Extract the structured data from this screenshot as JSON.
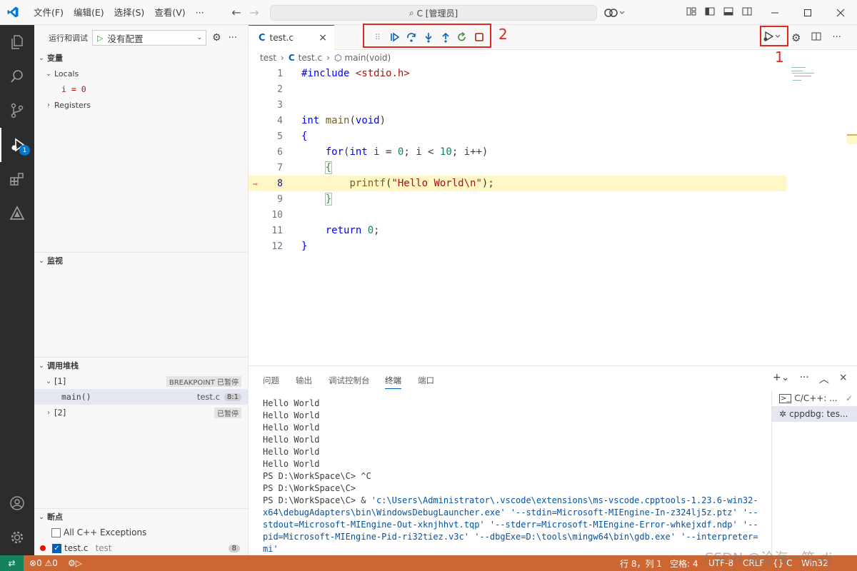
{
  "titlebar": {
    "menus": [
      "文件(F)",
      "编辑(E)",
      "选择(S)",
      "查看(V)",
      "···"
    ],
    "search_text": "C [管理员]"
  },
  "activitybar": {
    "debug_badge": "1"
  },
  "sidebar": {
    "header_label": "运行和调试",
    "config_select": "没有配置",
    "variables": {
      "title": "变量",
      "locals_label": "Locals",
      "local_var": "i = 0",
      "registers_label": "Registers"
    },
    "watch": {
      "title": "监视"
    },
    "callstack": {
      "title": "调用堆栈",
      "thread1": "[1]",
      "thread1_status": "BREAKPOINT 已暂停",
      "frame_fn": "main()",
      "frame_file": "test.c",
      "frame_pos": "8:1",
      "thread2": "[2]",
      "thread2_status": "已暂停"
    },
    "breakpoints": {
      "title": "断点",
      "all_exceptions": "All C++ Exceptions",
      "bp_file": "test.c",
      "bp_folder": "test",
      "bp_count": "8"
    }
  },
  "editor": {
    "tab_label": "test.c",
    "breadcrumb": [
      "test",
      "test.c",
      "main(void)"
    ],
    "current_line": 8
  },
  "panel": {
    "tabs": [
      "问题",
      "输出",
      "调试控制台",
      "终端",
      "端口"
    ],
    "active_tab": "终端",
    "terminal_lines": [
      "Hello World",
      "Hello World",
      "Hello World",
      "Hello World",
      "Hello World",
      "Hello World",
      "PS D:\\WorkSpace\\C> ^C",
      "PS D:\\WorkSpace\\C>"
    ],
    "terminal_cmd_prompt": "PS D:\\WorkSpace\\C>  & ",
    "terminal_cmd": "'c:\\Users\\Administrator\\.vscode\\extensions\\ms-vscode.cpptools-1.23.6-win32-x64\\debugAdapters\\bin\\WindowsDebugLauncher.exe' '--stdin=Microsoft-MIEngine-In-z324lj5z.ptz' '--stdout=Microsoft-MIEngine-Out-xknjhhvt.tqp' '--stderr=Microsoft-MIEngine-Error-whkejxdf.ndp' '--pid=Microsoft-MIEngine-Pid-ri32tiez.v3c' '--dbgExe=D:\\tools\\mingw64\\bin\\gdb.exe' '--interpreter=mi'",
    "terminal_list": [
      "C/C++: ...",
      "cppdbg: tes..."
    ]
  },
  "statusbar": {
    "errors": "0",
    "warnings": "0",
    "position": "行 8，列 1",
    "spaces": "空格: 4",
    "encoding": "UTF-8",
    "eol": "CRLF",
    "language": "{} C",
    "platform": "Win32",
    "watermark": "CSDN @沧海一笑-dj"
  },
  "annotations": {
    "label1": "1",
    "label2": "2"
  }
}
